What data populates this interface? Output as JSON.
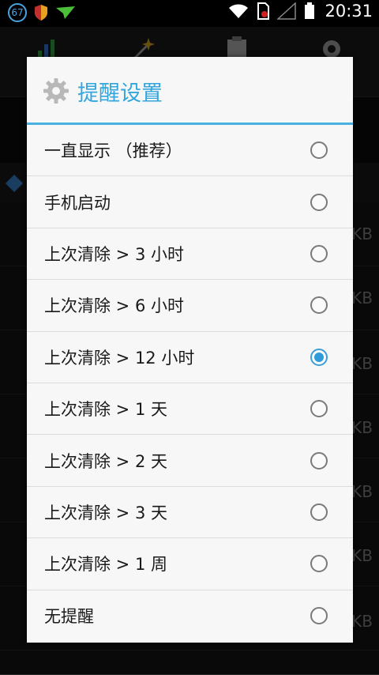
{
  "status_bar": {
    "notification_count": "67",
    "time": "20:31"
  },
  "background": {
    "row_size_unit": "KB"
  },
  "dialog": {
    "title": "提醒设置",
    "options": [
      {
        "label": "一直显示 （推荐）",
        "selected": false
      },
      {
        "label": "手机启动",
        "selected": false
      },
      {
        "label": "上次清除 > 3 小时",
        "selected": false
      },
      {
        "label": "上次清除 > 6 小时",
        "selected": false
      },
      {
        "label": "上次清除 > 12 小时",
        "selected": true
      },
      {
        "label": "上次清除 > 1 天",
        "selected": false
      },
      {
        "label": "上次清除 > 2 天",
        "selected": false
      },
      {
        "label": "上次清除 > 3 天",
        "selected": false
      },
      {
        "label": "上次清除 > 1 周",
        "selected": false
      },
      {
        "label": "无提醒",
        "selected": false
      }
    ]
  },
  "colors": {
    "accent": "#33a6dc",
    "radio_selected": "#2f9bd8"
  }
}
